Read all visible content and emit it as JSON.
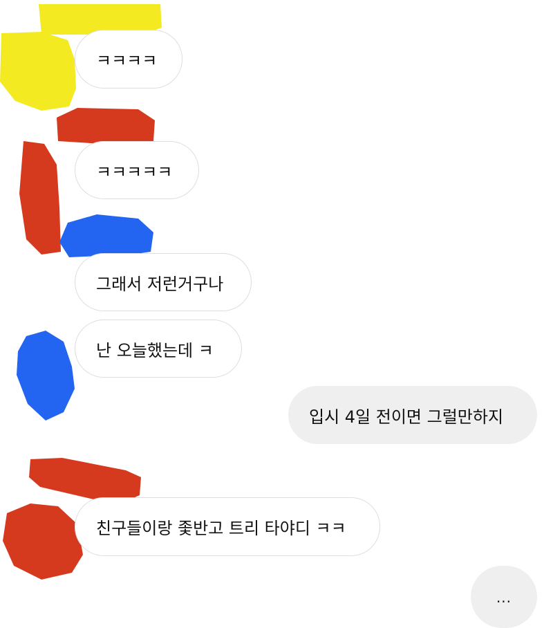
{
  "messages": [
    {
      "side": "received",
      "text": "ㅋㅋㅋㅋ"
    },
    {
      "side": "received",
      "text": "ㅋㅋㅋㅋㅋ"
    },
    {
      "side": "received",
      "text": "그래서 저런거구나"
    },
    {
      "side": "received",
      "text": "난 오늘했는데 ㅋ"
    },
    {
      "side": "sent",
      "text": "입시 4일 전이면 그럴만하지"
    },
    {
      "side": "received",
      "text": "친구들이랑 좇반고 트리 타야디 ㅋㅋ"
    }
  ],
  "typing_indicator": "...",
  "colors": {
    "sent_bubble_bg": "#efefef",
    "received_bubble_border": "#dedede",
    "redaction_yellow": "#f4ea22",
    "redaction_red": "#d63a1e",
    "redaction_blue": "#2364f0"
  }
}
